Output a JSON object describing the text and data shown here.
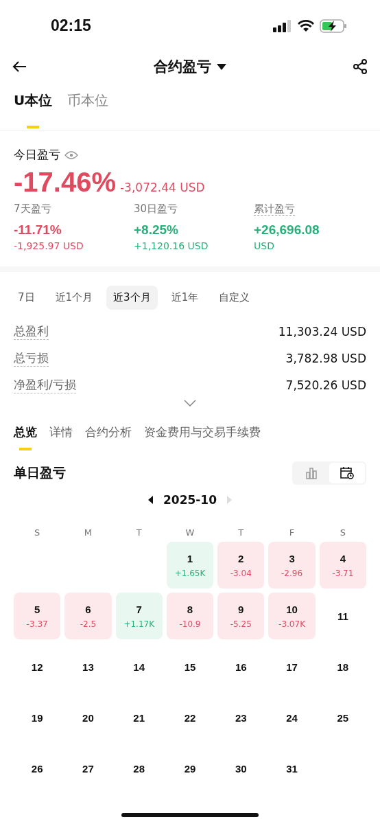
{
  "status_bar": {
    "time": "02:15"
  },
  "header": {
    "title": "合约盈亏"
  },
  "unit_tabs": [
    {
      "label": "U本位",
      "selected": true
    },
    {
      "label": "币本位",
      "selected": false
    }
  ],
  "today": {
    "label": "今日盈亏",
    "percent": "-17.46%",
    "amount": "-3,072.44 USD",
    "kind": "loss"
  },
  "stats": [
    {
      "label": "7天盈亏",
      "value": "-11.71%",
      "amount": "-1,925.97 USD",
      "kind": "loss",
      "dotted": false
    },
    {
      "label": "30日盈亏",
      "value": "+8.25%",
      "amount": "+1,120.16 USD",
      "kind": "gain",
      "dotted": false
    },
    {
      "label": "累计盈亏",
      "value": "+26,696.08",
      "amount": "USD",
      "kind": "gain",
      "dotted": true
    }
  ],
  "periods": [
    {
      "label": "7日",
      "selected": false
    },
    {
      "label": "近1个月",
      "selected": false
    },
    {
      "label": "近3个月",
      "selected": true
    },
    {
      "label": "近1年",
      "selected": false
    },
    {
      "label": "自定义",
      "selected": false
    }
  ],
  "summary": [
    {
      "label": "总盈利",
      "value": "11,303.24 USD"
    },
    {
      "label": "总亏损",
      "value": "3,782.98 USD"
    },
    {
      "label": "净盈利/亏损",
      "value": "7,520.26 USD"
    }
  ],
  "section_tabs": [
    {
      "label": "总览",
      "selected": true
    },
    {
      "label": "详情",
      "selected": false
    },
    {
      "label": "合约分析",
      "selected": false
    },
    {
      "label": "资金费用与交易手续费",
      "selected": false
    }
  ],
  "daily": {
    "title": "单日盈亏",
    "view_toggle": [
      {
        "kind": "chart",
        "selected": false
      },
      {
        "kind": "calendar",
        "selected": true
      }
    ],
    "month": "2025-10",
    "weekdays": [
      "S",
      "M",
      "T",
      "W",
      "T",
      "F",
      "S"
    ],
    "weeks": [
      {
        "days": [
          {
            "kind": "empty"
          },
          {
            "kind": "empty"
          },
          {
            "kind": "empty"
          },
          {
            "kind": "gain",
            "day": "1",
            "pnl": "+1.65K"
          },
          {
            "kind": "loss",
            "day": "2",
            "pnl": "-3.04"
          },
          {
            "kind": "loss",
            "day": "3",
            "pnl": "-2.96"
          },
          {
            "kind": "loss",
            "day": "4",
            "pnl": "-3.71"
          }
        ]
      },
      {
        "days": [
          {
            "kind": "loss",
            "day": "5",
            "pnl": "-3.37"
          },
          {
            "kind": "loss",
            "day": "6",
            "pnl": "-2.5"
          },
          {
            "kind": "gain",
            "day": "7",
            "pnl": "+1.17K"
          },
          {
            "kind": "loss",
            "day": "8",
            "pnl": "-10.9"
          },
          {
            "kind": "loss",
            "day": "9",
            "pnl": "-5.25"
          },
          {
            "kind": "loss",
            "day": "10",
            "pnl": "-3.07K"
          },
          {
            "kind": "plain",
            "day": "11"
          }
        ]
      },
      {
        "days": [
          {
            "kind": "plain",
            "day": "12"
          },
          {
            "kind": "plain",
            "day": "13"
          },
          {
            "kind": "plain",
            "day": "14"
          },
          {
            "kind": "plain",
            "day": "15"
          },
          {
            "kind": "plain",
            "day": "16"
          },
          {
            "kind": "plain",
            "day": "17"
          },
          {
            "kind": "plain",
            "day": "18"
          }
        ]
      },
      {
        "days": [
          {
            "kind": "plain",
            "day": "19"
          },
          {
            "kind": "plain",
            "day": "20"
          },
          {
            "kind": "plain",
            "day": "21"
          },
          {
            "kind": "plain",
            "day": "22"
          },
          {
            "kind": "plain",
            "day": "23"
          },
          {
            "kind": "plain",
            "day": "24"
          },
          {
            "kind": "plain",
            "day": "25"
          }
        ]
      },
      {
        "days": [
          {
            "kind": "plain",
            "day": "26"
          },
          {
            "kind": "plain",
            "day": "27"
          },
          {
            "kind": "plain",
            "day": "28"
          },
          {
            "kind": "plain",
            "day": "29"
          },
          {
            "kind": "plain",
            "day": "30"
          },
          {
            "kind": "plain",
            "day": "31"
          },
          {
            "kind": "empty"
          }
        ]
      }
    ]
  }
}
